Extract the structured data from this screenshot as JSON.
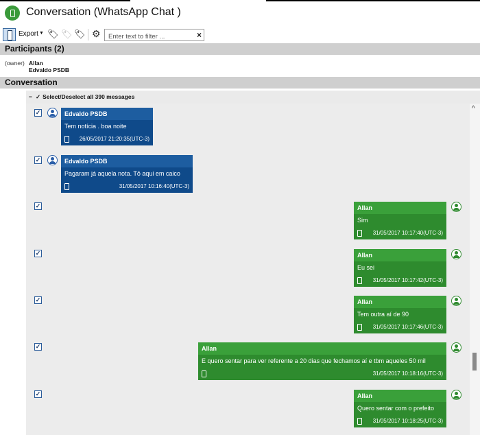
{
  "window": {
    "title": "Conversation (WhatsApp Chat )"
  },
  "toolbar": {
    "export_label": "Export",
    "filter_placeholder": "Enter text to filter ...",
    "clear_symbol": "×"
  },
  "participants": {
    "header": "Participants (2)",
    "owner_tag": "(owner)",
    "names": [
      "Allan",
      "Edvaldo PSDB"
    ]
  },
  "conversation": {
    "header": "Conversation",
    "select_all_label": "Select/Deselect all 390 messages"
  },
  "colors": {
    "incoming_bubble": "#0f4a8a",
    "outgoing_bubble": "#2e8b2e",
    "section_header": "#cfcfcf"
  },
  "messages": [
    {
      "sender": "Edvaldo PSDB",
      "direction": "in",
      "text": "Tem notícia . boa noite",
      "timestamp": "26/05/2017 21:20:35(UTC-3)",
      "checked": true
    },
    {
      "sender": "Edvaldo PSDB",
      "direction": "in",
      "text": "Pagaram já aquela nota. Tô aqui em caico",
      "timestamp": "31/05/2017 10:16:40(UTC-3)",
      "checked": true
    },
    {
      "sender": "Allan",
      "direction": "out",
      "text": "Sim",
      "timestamp": "31/05/2017 10:17:40(UTC-3)",
      "checked": true
    },
    {
      "sender": "Allan",
      "direction": "out",
      "text": "Eu sei",
      "timestamp": "31/05/2017 10:17:42(UTC-3)",
      "checked": true
    },
    {
      "sender": "Allan",
      "direction": "out",
      "text": "Tem outra aí de 90",
      "timestamp": "31/05/2017 10:17:46(UTC-3)",
      "checked": true
    },
    {
      "sender": "Allan",
      "direction": "out",
      "text": "E quero sentar para ver referente a 20 dias que fechamos aí e tbm aqueles 50 mil",
      "timestamp": "31/05/2017 10:18:16(UTC-3)",
      "checked": true
    },
    {
      "sender": "Allan",
      "direction": "out",
      "text": "Quero sentar com o prefeito",
      "timestamp": "31/05/2017 10:18:25(UTC-3)",
      "checked": true
    }
  ]
}
